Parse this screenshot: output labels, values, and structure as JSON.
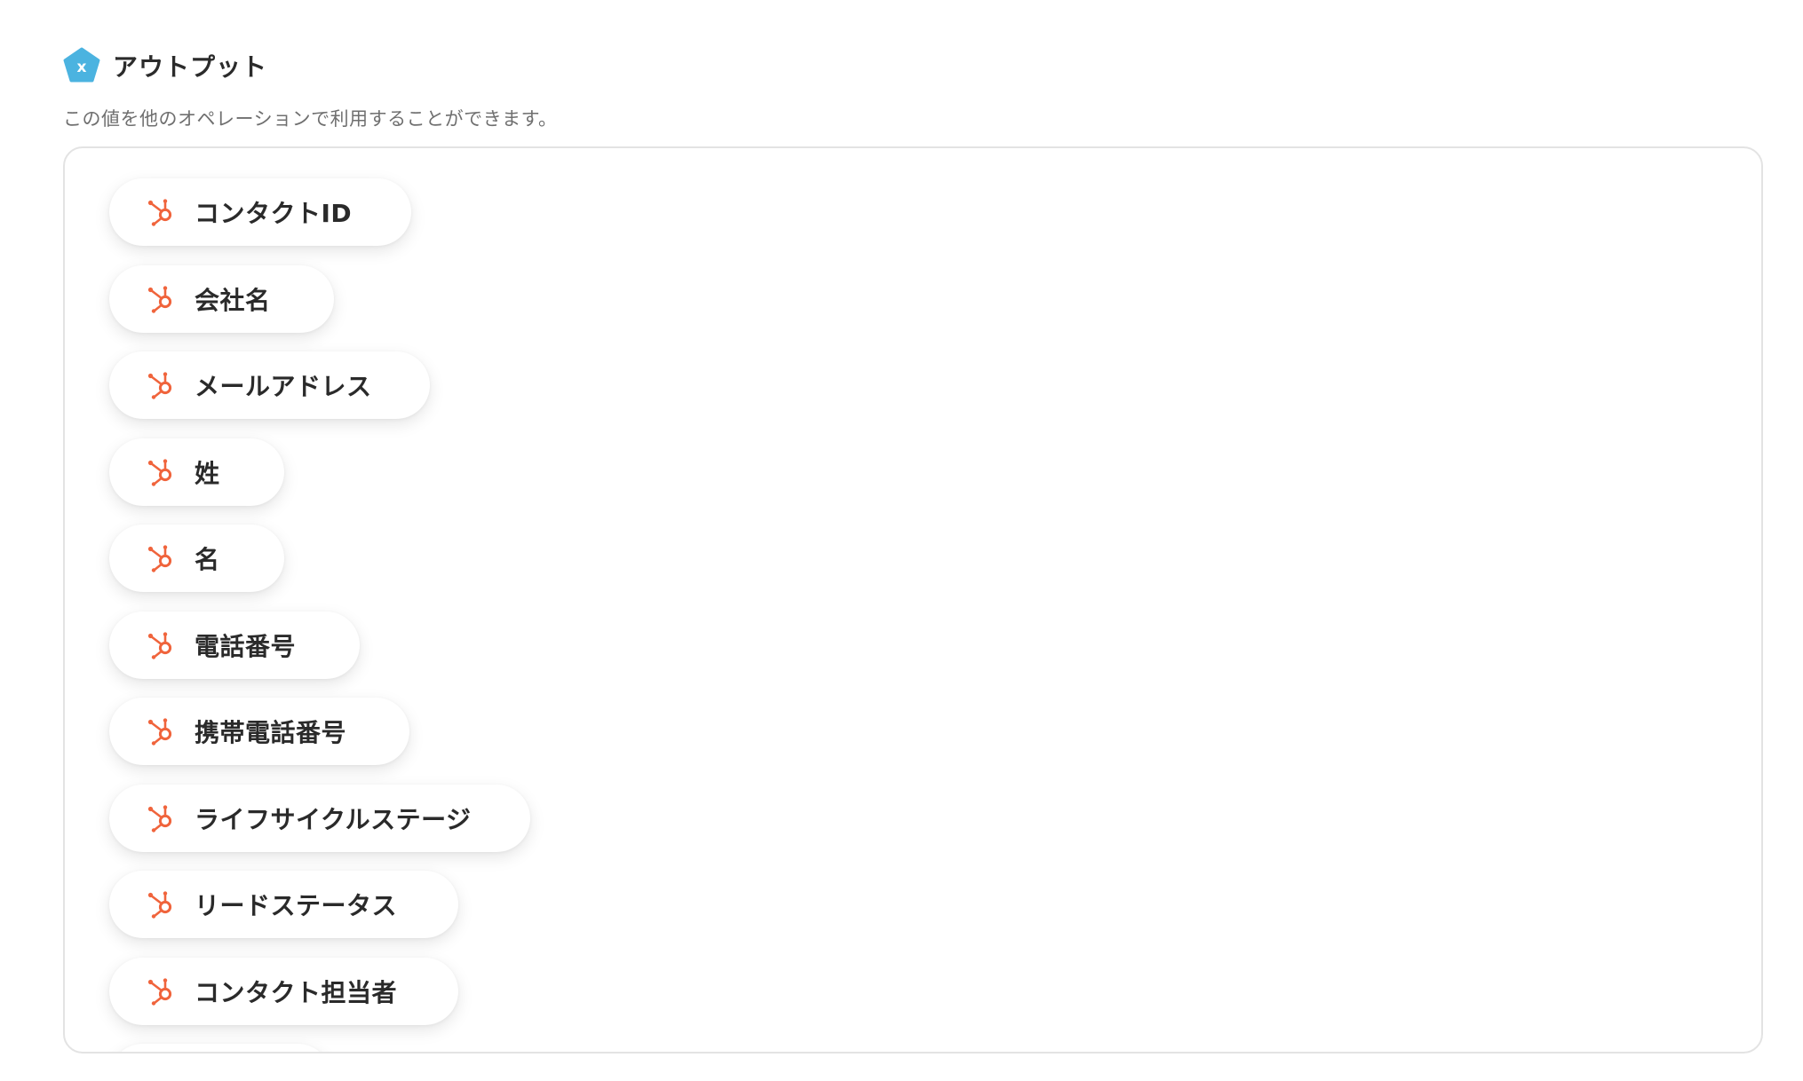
{
  "output": {
    "title": "アウトプット",
    "description": "この値を他のオペレーションで利用することができます。",
    "icon_glyph": "x",
    "icon_color": "#4bb3e0"
  },
  "chips": [
    {
      "label": "コンタクトID",
      "icon": "hubspot-icon"
    },
    {
      "label": "会社名",
      "icon": "hubspot-icon"
    },
    {
      "label": "メールアドレス",
      "icon": "hubspot-icon"
    },
    {
      "label": "姓",
      "icon": "hubspot-icon"
    },
    {
      "label": "名",
      "icon": "hubspot-icon"
    },
    {
      "label": "電話番号",
      "icon": "hubspot-icon"
    },
    {
      "label": "携帯電話番号",
      "icon": "hubspot-icon"
    },
    {
      "label": "ライフサイクルステージ",
      "icon": "hubspot-icon"
    },
    {
      "label": "リードステータス",
      "icon": "hubspot-icon"
    },
    {
      "label": "コンタクト担当者",
      "icon": "hubspot-icon"
    },
    {
      "label": "",
      "icon": "hubspot-icon"
    }
  ],
  "colors": {
    "hubspot": "#f0643c",
    "border": "#e3e3e3"
  }
}
